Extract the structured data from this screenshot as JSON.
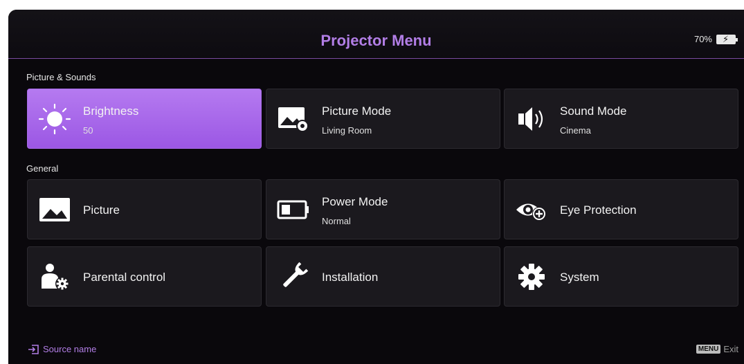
{
  "header": {
    "title": "Projector Menu",
    "battery_percent": "70%",
    "battery_icon": "battery-charging-icon"
  },
  "sections": [
    {
      "label": "Picture & Sounds",
      "tiles": [
        {
          "name": "Brightness",
          "value": "50",
          "icon": "brightness-icon",
          "selected": true
        },
        {
          "name": "Picture Mode",
          "value": "Living Room",
          "icon": "picture-mode-icon",
          "selected": false
        },
        {
          "name": "Sound Mode",
          "value": "Cinema",
          "icon": "speaker-icon",
          "selected": false
        }
      ]
    },
    {
      "label": "General",
      "tiles": [
        {
          "name": "Picture",
          "icon": "picture-icon"
        },
        {
          "name": "Power Mode",
          "value": "Normal",
          "icon": "battery-icon"
        },
        {
          "name": "Eye Protection",
          "icon": "eye-protection-icon"
        },
        {
          "name": "Parental control",
          "icon": "parental-control-icon"
        },
        {
          "name": "Installation",
          "icon": "wrench-icon"
        },
        {
          "name": "System",
          "icon": "gear-icon"
        }
      ]
    }
  ],
  "footer": {
    "source_label": "Source name",
    "menu_key": "MENU",
    "exit_label": "Exit"
  },
  "colors": {
    "accent": "#b27ee6",
    "selected_tile": "#a86be9",
    "background": "#0a080c",
    "tile": "#1b191e"
  }
}
